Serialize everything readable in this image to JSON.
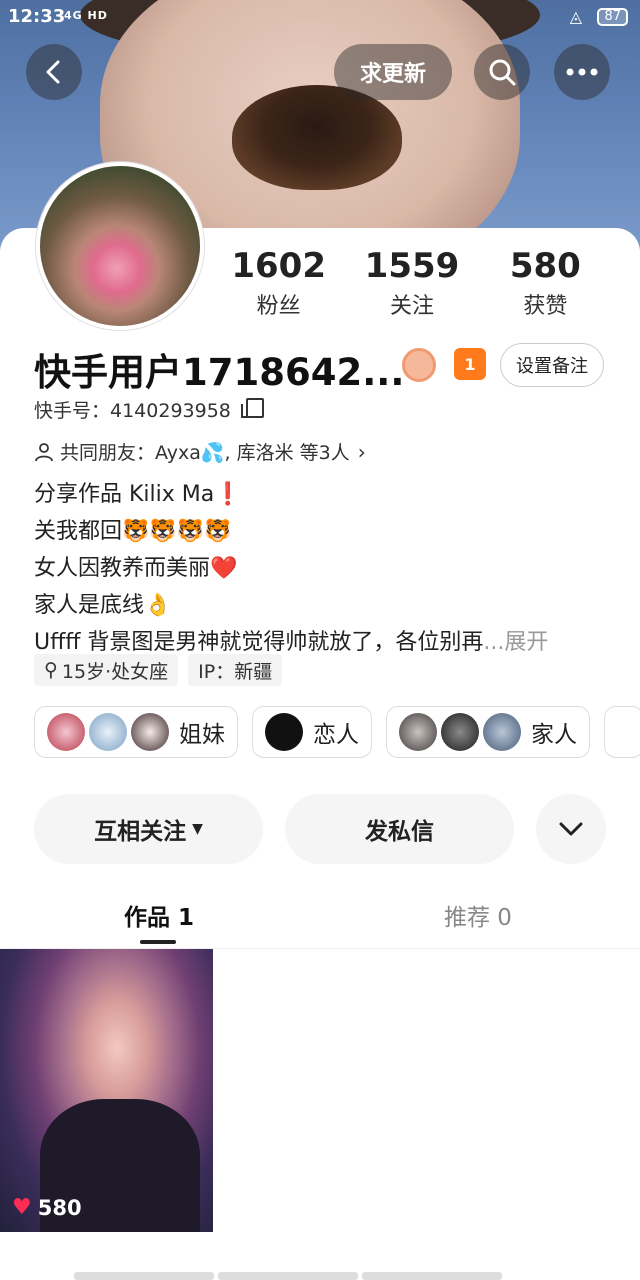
{
  "status_bar": {
    "time": "12:33",
    "network": "4G HD",
    "battery": "87"
  },
  "header": {
    "update_label": "求更新"
  },
  "stats": [
    {
      "value": "1602",
      "label": "粉丝"
    },
    {
      "value": "1559",
      "label": "关注"
    },
    {
      "value": "580",
      "label": "获赞"
    }
  ],
  "profile": {
    "name": "快手用户1718642...",
    "badge_level": "1",
    "remark_label": "设置备注",
    "kuaishou_id": "快手号：4140293958",
    "mutual_friends": "共同朋友：Ayxa💦, 库洛米 等3人",
    "bio": [
      "分享作品 Kilix Ma❗",
      "关我都回🐯🐯🐯🐯",
      "女人因教养而美丽❤️",
      "家人是底线👌",
      "Uffff 背景图是男神就觉得帅就放了，各位别再"
    ],
    "bio_more": "...展开",
    "tags": [
      "15岁·处女座",
      "IP：新疆"
    ]
  },
  "groups": [
    {
      "label": "姐妹"
    },
    {
      "label": "恋人"
    },
    {
      "label": "家人"
    }
  ],
  "actions": {
    "follow_label": "互相关注",
    "message_label": "发私信"
  },
  "tabs": [
    {
      "label": "作品 1",
      "active": true
    },
    {
      "label": "推荐 0",
      "active": false
    }
  ],
  "videos": [
    {
      "likes": "580"
    }
  ]
}
